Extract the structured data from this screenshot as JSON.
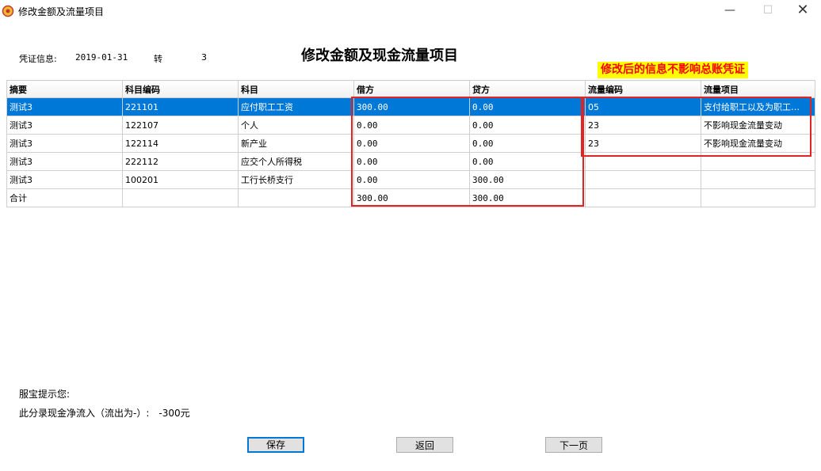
{
  "window": {
    "title": "修改金额及流量项目"
  },
  "voucher": {
    "label": "凭证信息:",
    "date": "2019-01-31",
    "type": "转",
    "number": "3"
  },
  "page_title": "修改金额及现金流量项目",
  "annotation": "修改后的信息不影响总账凭证",
  "table": {
    "headers": [
      "摘要",
      "科目编码",
      "科目",
      "借方",
      "贷方",
      "流量编码",
      "流量项目"
    ],
    "rows": [
      [
        "测试3",
        "221101",
        "应付职工工资",
        "300.00",
        "0.00",
        "05",
        "支付给职工以及为职工…"
      ],
      [
        "测试3",
        "122107",
        "个人",
        "0.00",
        "0.00",
        "23",
        "不影响现金流量变动"
      ],
      [
        "测试3",
        "122114",
        "新产业",
        "0.00",
        "0.00",
        "23",
        "不影响现金流量变动"
      ],
      [
        "测试3",
        "222112",
        "应交个人所得税",
        "0.00",
        "0.00",
        "",
        ""
      ],
      [
        "测试3",
        "100201",
        "工行长桥支行",
        "0.00",
        "300.00",
        "",
        ""
      ]
    ],
    "total": [
      "合计",
      "",
      "",
      "300.00",
      "300.00",
      "",
      ""
    ]
  },
  "tips": {
    "title": "服宝提示您:",
    "net_flow_label": "此分录现金净流入（流出为-）:",
    "net_flow_value": "-300元"
  },
  "buttons": {
    "save": "保存",
    "back": "返回",
    "next": "下一页"
  },
  "colors": {
    "selection": "#0078d7",
    "highlight_box": "#e02424",
    "note_bg": "#ffff00",
    "note_text": "#ff0000"
  }
}
